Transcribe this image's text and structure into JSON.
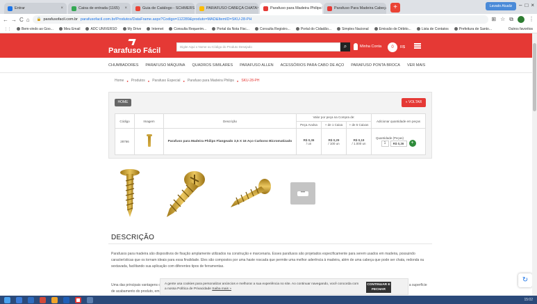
{
  "browser": {
    "tabs": [
      {
        "label": "Entrar",
        "color": "#1a73e8",
        "active": false
      },
      {
        "label": "Caixa de entrada (1165)",
        "color": "#34a853",
        "active": false
      },
      {
        "label": "Guia de Catálogo - SCHMERSAL",
        "color": "#ea4335",
        "active": false
      },
      {
        "label": "PARAFUSO CABEÇA CHATA",
        "color": "#fbbc05",
        "active": false
      },
      {
        "label": "Parafuso para Madeira Philips",
        "color": "#e53935",
        "active": true
      },
      {
        "label": "Parafuso Para Madeira Cabeça",
        "color": "#e53935",
        "active": false
      }
    ],
    "profile": "Lavado Atualiz",
    "url": "parafusofacil.com.br/Produtos/DataFrame.aspx?Codigo=112289&produto=MAD&ItemID=SKU-28-PH",
    "url_host": "parafusofacil.com.br",
    "bookmarks": [
      "Bem-vindo ao Goo...",
      "Meu Email",
      "ADC UNIVERSO",
      "My Drive",
      "Internet",
      "Consulta Requerim...",
      "Portal da Nota Fisc...",
      "Consulta Registro...",
      "Portal do Cidadão...",
      "Simples Nacional",
      "Emissão de Débito...",
      "Lista de Contatos",
      "Prefeitura de Santo..."
    ],
    "bookmarks_right": "Outros favoritos"
  },
  "site": {
    "logo": "Parafuso Fácil",
    "search_placeholder": "Digite Aqui o Nome ou Código do Produto Desejado",
    "account": "Minha Conta",
    "cart_count": "0",
    "cart_value": "R$",
    "nav": [
      "Chumbadores",
      "Parafuso Máquina",
      "Quadros Similares",
      "Parafuso Allen",
      "Acessórios para Cabo de Aço",
      "Parafuso Ponta Broca",
      "Ver Mais"
    ]
  },
  "breadcrumb": [
    "Home",
    "Produtos",
    "Parafuso Especial",
    "Parafuso para Madeira Philips",
    "SKU-28-PH"
  ],
  "product_panel": {
    "home_label": "HOME",
    "back_label": "VOLTAR",
    "columns": {
      "code": "Código",
      "image": "Imagem",
      "description": "Descrição",
      "price_group": "Valor por peça na Compra de:",
      "price_cols": [
        "Peça Avulsa",
        "+ de 1 Caixa",
        "+ de 5 Caixas"
      ],
      "add": "Adicionar quantidade em peças"
    },
    "row": {
      "code": "28766",
      "description": "Parafuso para Madeira Philips Flangeado 3,5 X 16 Aço Carbono Bicromatizado",
      "prices": [
        {
          "value": "R$ 0,36",
          "unit": "/ un"
        },
        {
          "value": "R$ 0,29",
          "unit": "/ 100 un"
        },
        {
          "value": "R$ 0,19",
          "unit": "/ 1.000 un"
        }
      ],
      "qty_label": "Quantidade (Peças)",
      "qty": "1",
      "total": "R$ 0,36",
      "add_icon": "+"
    }
  },
  "gallery": {
    "more": "•••"
  },
  "description": {
    "title": "DESCRIÇÃO",
    "p1": "Parafusos para madeira são dispositivos de fixação amplamente utilizados na construção e marcenaria. Esses parafusos são projetados especificamente para serem usados em madeira, possuindo características que os tornam ideais para essa finalidade. Eles são compostos por uma haste roscada que permite uma melhor aderência à madeira, além de uma cabeça que pode ser chata, redonda ou sextavada, facilitando sua aplicação com diferentes tipos de ferramentas.",
    "p2": "Uma das principais vantagens dos parafusos para madeira é a sua resistência e durabilidade, o que permite que eles mantenham a fixação por longos períodos sem comprometer a estrutura, e a superfície de acabamento do produto, em resistência e ..."
  },
  "cookie": {
    "text": "A gente usa cookies para personalizar anúncios e melhorar a sua experiência no site. Ao continuar navegando, você concorda com a nossa Política de Privacidade",
    "link": "Saiba mais »",
    "button": "CONTINUAR E FECHAR"
  },
  "taskbar": {
    "clock": "15:02"
  },
  "colors": {
    "brand": "#e53935",
    "add_green": "#2e8b3a"
  }
}
